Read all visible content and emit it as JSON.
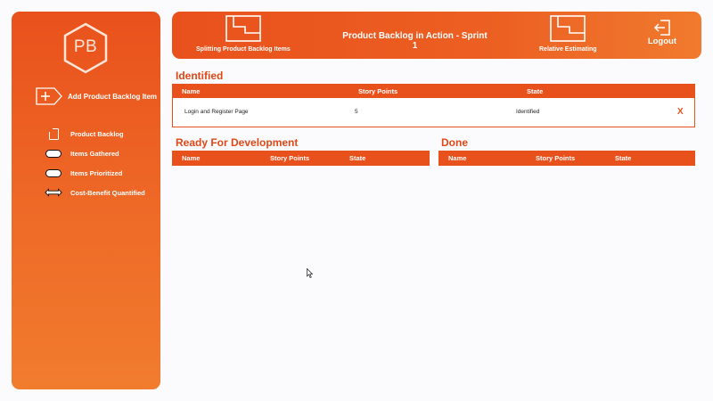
{
  "sidebar": {
    "logo_text": "PB",
    "add_item_label": "Add Product Backlog Item",
    "items": [
      {
        "label": "Product Backlog",
        "icon": "document-icon"
      },
      {
        "label": "Items Gathered",
        "icon": "pill-icon"
      },
      {
        "label": "Items Prioritized",
        "icon": "pill-icon"
      },
      {
        "label": "Cost-Benefit Quantified",
        "icon": "double-arrow-icon"
      }
    ]
  },
  "header": {
    "left_button_label": "Splitting Product Backlog Items",
    "title": "Product Backlog in Action - Sprint 1",
    "right_button_label": "Relative Estimating",
    "logout_label": "Logout"
  },
  "identified": {
    "title": "Identified",
    "columns": [
      "Name",
      "Story Points",
      "State"
    ],
    "rows": [
      {
        "name": "Login and Register Page",
        "points": "5",
        "state": "Identified",
        "delete": "X"
      }
    ]
  },
  "ready": {
    "title": "Ready For Development",
    "columns": [
      "Name",
      "Story Points",
      "State"
    ]
  },
  "done": {
    "title": "Done",
    "columns": [
      "Name",
      "Story Points",
      "State"
    ]
  },
  "colors": {
    "accent": "#e9511c",
    "accent_light": "#f17c2e",
    "section_title": "#df4816",
    "background": "#fbfbfd"
  }
}
